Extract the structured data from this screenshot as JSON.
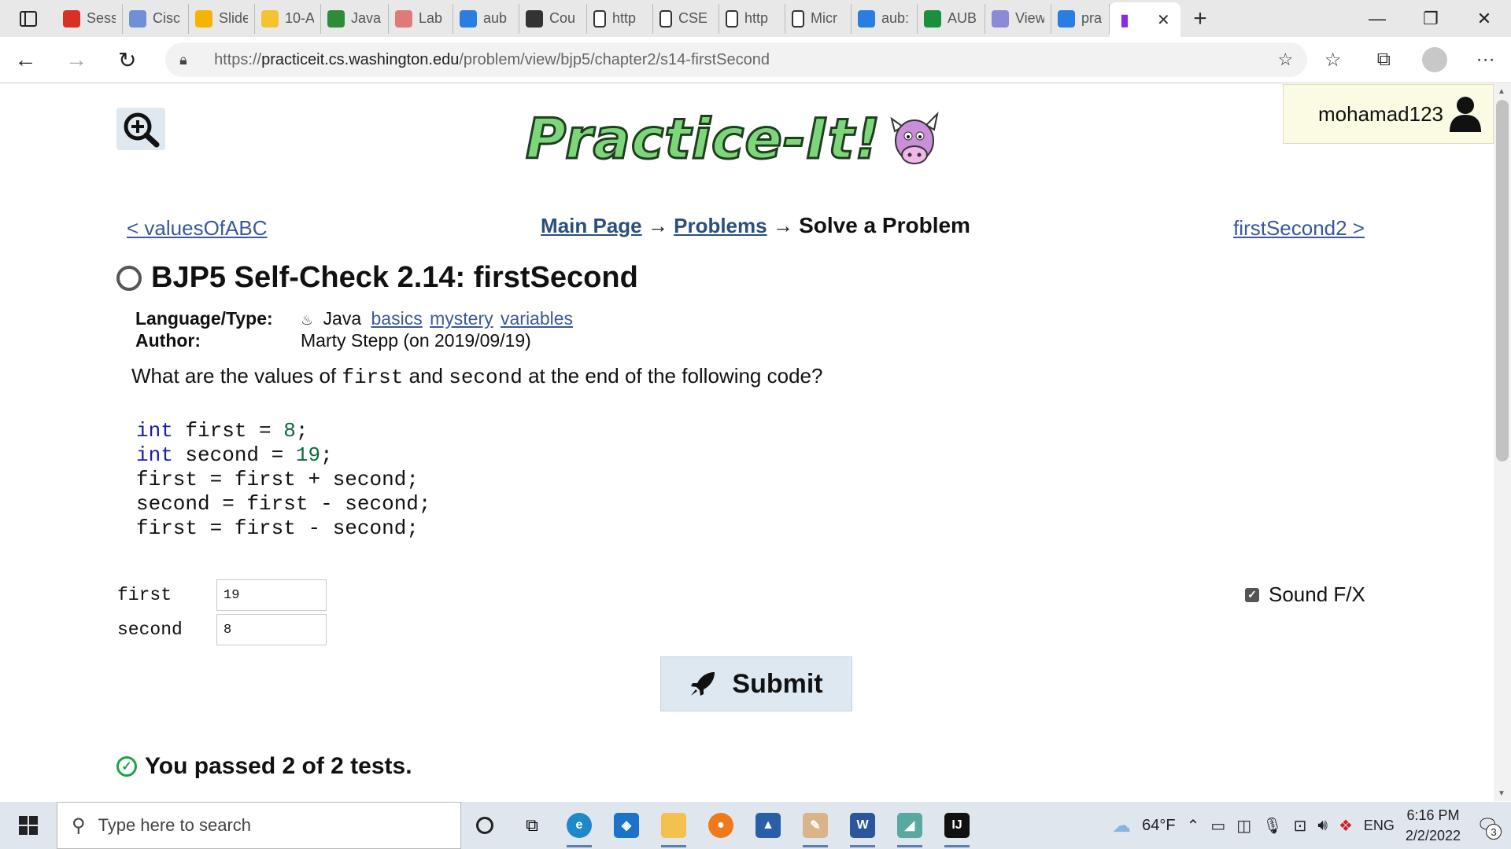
{
  "browser": {
    "tabs": [
      {
        "label": "Sess",
        "icon": "gmail-icon",
        "color": "#d93025"
      },
      {
        "label": "Cisc",
        "icon": "cisco-icon",
        "color": "#6f8fd6"
      },
      {
        "label": "Slide",
        "icon": "google-slides-icon",
        "color": "#f4b400"
      },
      {
        "label": "10-A",
        "icon": "notes-icon",
        "color": "#f4c430"
      },
      {
        "label": "Java",
        "icon": "w3schools-icon",
        "color": "#2e8b3a"
      },
      {
        "label": "Lab",
        "icon": "pdf-icon",
        "color": "#e07a7a"
      },
      {
        "label": "aub",
        "icon": "bing-icon",
        "color": "#2a7de1"
      },
      {
        "label": "Cou",
        "icon": "moodle-icon",
        "color": "#333333"
      },
      {
        "label": "http",
        "icon": "page-icon",
        "color": "#ffffff"
      },
      {
        "label": "CSE",
        "icon": "page-icon",
        "color": "#ffffff"
      },
      {
        "label": "http",
        "icon": "page-icon",
        "color": "#ffffff"
      },
      {
        "label": "Micr",
        "icon": "page-icon",
        "color": "#ffffff"
      },
      {
        "label": "aub:",
        "icon": "bing-icon",
        "color": "#2a7de1"
      },
      {
        "label": "AUB",
        "icon": "aub-icon",
        "color": "#1a8f3c"
      },
      {
        "label": "View",
        "icon": "view-icon",
        "color": "#8a8ad6"
      },
      {
        "label": "prac",
        "icon": "bing-icon",
        "color": "#2a7de1"
      }
    ],
    "url_prefix": "https://",
    "url_host": "practiceit.cs.washington.edu",
    "url_path": "/problem/view/bjp5/chapter2/s14-firstSecond"
  },
  "page": {
    "username": "mohamad123",
    "logo_text": "Practice-It!",
    "prev_link": "< valuesOfABC",
    "next_link": "firstSecond2 >",
    "breadcrumb": {
      "main": "Main Page",
      "arrow": "→",
      "problems": "Problems",
      "current": "Solve a Problem"
    },
    "title": "BJP5 Self-Check 2.14: firstSecond",
    "meta": {
      "language_label": "Language/Type:",
      "language": "Java",
      "tags": [
        "basics",
        "mystery",
        "variables"
      ],
      "author_label": "Author:",
      "author": "Marty Stepp (on 2019/09/19)"
    },
    "question": {
      "before": "What are the values of ",
      "var1": "first",
      "mid": " and ",
      "var2": "second",
      "after": " at the end of the following code?"
    },
    "code_lines": [
      "int first = 8;",
      "int second = 19;",
      "first = first + second;",
      "second = first - second;",
      "first = first - second;"
    ],
    "answers": [
      {
        "label": "first",
        "value": "19"
      },
      {
        "label": "second",
        "value": "8"
      }
    ],
    "sound_label": "Sound F/X",
    "sound_checked": true,
    "submit_label": "Submit",
    "result": "You passed 2 of 2 tests."
  },
  "taskbar": {
    "search_placeholder": "Type here to search",
    "weather": "64°F",
    "language": "ENG",
    "time": "6:16 PM",
    "date": "2/2/2022",
    "notifications": "3"
  }
}
